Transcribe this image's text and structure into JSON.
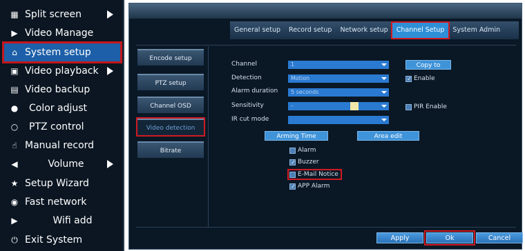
{
  "left_menu": {
    "items": [
      {
        "label": "Split screen",
        "icon": "grid-icon",
        "has_arrow": true
      },
      {
        "label": "Video Manage",
        "icon": "camera-icon",
        "has_arrow": false
      },
      {
        "label": "System setup",
        "icon": "home-icon",
        "has_arrow": false,
        "active": true
      },
      {
        "label": "Video playback",
        "icon": "film-icon",
        "has_arrow": true
      },
      {
        "label": "Video backup",
        "icon": "save-icon",
        "has_arrow": false
      },
      {
        "label": "Color adjust",
        "icon": "palette-icon",
        "has_arrow": false
      },
      {
        "label": "PTZ control",
        "icon": "ptz-icon",
        "has_arrow": false
      },
      {
        "label": "Manual record",
        "icon": "hand-icon",
        "has_arrow": false
      },
      {
        "label": "Volume",
        "icon": "speaker-icon",
        "has_arrow": true
      },
      {
        "label": "Setup Wizard",
        "icon": "wizard-icon",
        "has_arrow": false
      },
      {
        "label": "Fast network",
        "icon": "globe-icon",
        "has_arrow": false
      },
      {
        "label": "Wifi add",
        "icon": "wifi-camera-icon",
        "has_arrow": false
      },
      {
        "label": "Exit System",
        "icon": "power-icon",
        "has_arrow": false
      }
    ]
  },
  "tabs": [
    {
      "label": "General setup"
    },
    {
      "label": "Record setup"
    },
    {
      "label": "Network setup"
    },
    {
      "label": "Channel Setup",
      "active": true
    },
    {
      "label": "System Admin"
    }
  ],
  "side_nav": [
    {
      "label": "Encode setup"
    },
    {
      "label": "PTZ setup"
    },
    {
      "label": "Channel OSD"
    },
    {
      "label": "Video detection",
      "active": true
    },
    {
      "label": "Bitrate"
    }
  ],
  "form": {
    "channel_label": "Channel",
    "channel_value": "1",
    "detection_label": "Detection",
    "detection_value": "Motion",
    "alarm_duration_label": "Alarm duration",
    "alarm_duration_value": "5 seconds",
    "sensitivity_label": "Sensitivity",
    "sensitivity_level": 0.74,
    "ir_cut_label": "IR cut mode",
    "ir_cut_value": "",
    "copy_to_label": "Copy to",
    "enable_label": "Enable",
    "enable_checked": true,
    "pir_enable_label": "PIR Enable",
    "pir_enable_checked": false,
    "arming_time_label": "Arming Time",
    "area_edit_label": "Area edit"
  },
  "actions": [
    {
      "label": "Alarm",
      "checked": false
    },
    {
      "label": "Buzzer",
      "checked": true
    },
    {
      "label": "E-Mail Notice",
      "checked": false,
      "highlight": true
    },
    {
      "label": "APP Alarm",
      "checked": true
    }
  ],
  "footer": {
    "apply_label": "Apply",
    "ok_label": "Ok",
    "cancel_label": "Cancel"
  },
  "colors": {
    "highlight": "#d21a22",
    "active_blue": "#2e8fd6",
    "panel_bg": "#0a1826"
  }
}
